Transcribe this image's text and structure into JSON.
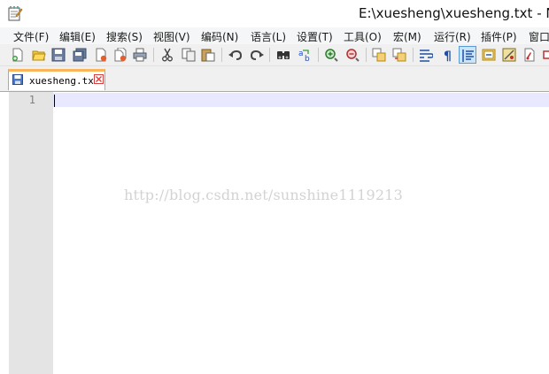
{
  "window": {
    "title": "E:\\xuesheng\\xuesheng.txt - N"
  },
  "menu": [
    {
      "label": "文件(F)"
    },
    {
      "label": "编辑(E)"
    },
    {
      "label": "搜索(S)"
    },
    {
      "label": "视图(V)"
    },
    {
      "label": "编码(N)"
    },
    {
      "label": "语言(L)"
    },
    {
      "label": "设置(T)"
    },
    {
      "label": "工具(O)"
    },
    {
      "label": "宏(M)"
    },
    {
      "label": "运行(R)"
    },
    {
      "label": "插件(P)"
    },
    {
      "label": "窗口"
    }
  ],
  "toolbar": {
    "icons": [
      "new-file-icon",
      "open-file-icon",
      "save-icon",
      "save-all-icon",
      "close-icon",
      "close-all-icon",
      "print-icon",
      "cut-icon",
      "copy-icon",
      "paste-icon",
      "undo-icon",
      "redo-icon",
      "find-icon",
      "replace-icon",
      "zoom-in-icon",
      "zoom-out-icon",
      "sync-vertical-icon",
      "sync-horizontal-icon",
      "word-wrap-icon",
      "show-all-chars-icon",
      "indent-guide-icon",
      "doc-map-icon",
      "function-list-icon",
      "macro-record-icon",
      "macro-stop-icon"
    ],
    "active_icon": "indent-guide-icon"
  },
  "tabs": [
    {
      "label": "xuesheng.txt"
    }
  ],
  "editor": {
    "line_numbers": [
      "1"
    ],
    "current_line_color": "#e8e8ff"
  },
  "watermark": "http://blog.csdn.net/sunshine1119213",
  "colors": {
    "tab_accent": "#fab55a",
    "gutter": "#e4e4e4",
    "toolbar_bg": "#f0f0f0"
  }
}
